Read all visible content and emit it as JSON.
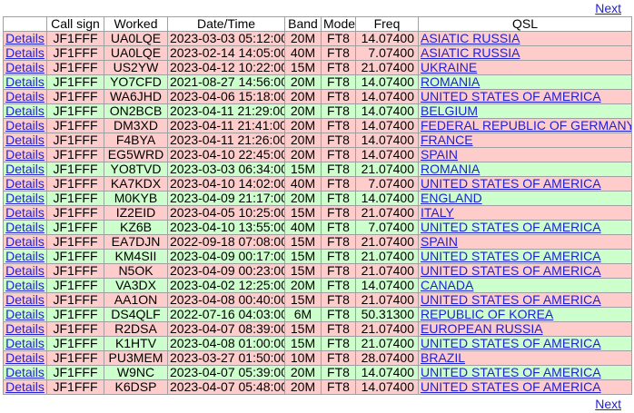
{
  "nav": {
    "next_label": "Next"
  },
  "table": {
    "headers": [
      "",
      "Call sign",
      "Worked",
      "Date/Time",
      "Band",
      "Mode",
      "Freq",
      "QSL"
    ],
    "details_label": "Details",
    "rows": [
      {
        "call": "JF1FFF",
        "worked": "UA0LQE",
        "datetime": "2023-03-03 05:12:00",
        "band": "20M",
        "mode": "FT8",
        "freq": "14.07400",
        "qsl": "ASIATIC RUSSIA",
        "color": "pink"
      },
      {
        "call": "JF1FFF",
        "worked": "UA0LQE",
        "datetime": "2023-02-14 14:05:00",
        "band": "40M",
        "mode": "FT8",
        "freq": "7.07400",
        "qsl": "ASIATIC RUSSIA",
        "color": "pink"
      },
      {
        "call": "JF1FFF",
        "worked": "US2YW",
        "datetime": "2023-04-12 10:22:00",
        "band": "15M",
        "mode": "FT8",
        "freq": "21.07400",
        "qsl": "UKRAINE",
        "color": "pink"
      },
      {
        "call": "JF1FFF",
        "worked": "YO7CFD",
        "datetime": "2021-08-27 14:56:00",
        "band": "20M",
        "mode": "FT8",
        "freq": "14.07400",
        "qsl": "ROMANIA",
        "color": "green"
      },
      {
        "call": "JF1FFF",
        "worked": "WA6JHD",
        "datetime": "2023-04-06 15:18:00",
        "band": "20M",
        "mode": "FT8",
        "freq": "14.07400",
        "qsl": "UNITED STATES OF AMERICA",
        "color": "pink"
      },
      {
        "call": "JF1FFF",
        "worked": "ON2BCB",
        "datetime": "2023-04-11 21:29:00",
        "band": "20M",
        "mode": "FT8",
        "freq": "14.07400",
        "qsl": "BELGIUM",
        "color": "green"
      },
      {
        "call": "JF1FFF",
        "worked": "DM3XD",
        "datetime": "2023-04-11 21:41:00",
        "band": "20M",
        "mode": "FT8",
        "freq": "14.07400",
        "qsl": "FEDERAL REPUBLIC OF GERMANY",
        "color": "pink"
      },
      {
        "call": "JF1FFF",
        "worked": "F4BYA",
        "datetime": "2023-04-11 21:26:00",
        "band": "20M",
        "mode": "FT8",
        "freq": "14.07400",
        "qsl": "FRANCE",
        "color": "pink"
      },
      {
        "call": "JF1FFF",
        "worked": "EG5WRD",
        "datetime": "2023-04-10 22:45:00",
        "band": "20M",
        "mode": "FT8",
        "freq": "14.07400",
        "qsl": "SPAIN",
        "color": "pink"
      },
      {
        "call": "JF1FFF",
        "worked": "YO8TVD",
        "datetime": "2023-03-03 06:34:00",
        "band": "15M",
        "mode": "FT8",
        "freq": "21.07400",
        "qsl": "ROMANIA",
        "color": "green"
      },
      {
        "call": "JF1FFF",
        "worked": "KA7KDX",
        "datetime": "2023-04-10 14:02:00",
        "band": "40M",
        "mode": "FT8",
        "freq": "7.07400",
        "qsl": "UNITED STATES OF AMERICA",
        "color": "pink"
      },
      {
        "call": "JF1FFF",
        "worked": "M0KYB",
        "datetime": "2023-04-09 21:17:00",
        "band": "20M",
        "mode": "FT8",
        "freq": "14.07400",
        "qsl": "ENGLAND",
        "color": "green"
      },
      {
        "call": "JF1FFF",
        "worked": "IZ2EID",
        "datetime": "2023-04-05 10:25:00",
        "band": "15M",
        "mode": "FT8",
        "freq": "21.07400",
        "qsl": "ITALY",
        "color": "pink"
      },
      {
        "call": "JF1FFF",
        "worked": "KZ6B",
        "datetime": "2023-04-10 13:55:00",
        "band": "40M",
        "mode": "FT8",
        "freq": "7.07400",
        "qsl": "UNITED STATES OF AMERICA",
        "color": "green"
      },
      {
        "call": "JF1FFF",
        "worked": "EA7DJN",
        "datetime": "2022-09-18 07:08:00",
        "band": "15M",
        "mode": "FT8",
        "freq": "21.07400",
        "qsl": "SPAIN",
        "color": "pink"
      },
      {
        "call": "JF1FFF",
        "worked": "KM4SII",
        "datetime": "2023-04-09 00:17:00",
        "band": "15M",
        "mode": "FT8",
        "freq": "21.07400",
        "qsl": "UNITED STATES OF AMERICA",
        "color": "green"
      },
      {
        "call": "JF1FFF",
        "worked": "N5OK",
        "datetime": "2023-04-09 00:23:00",
        "band": "15M",
        "mode": "FT8",
        "freq": "21.07400",
        "qsl": "UNITED STATES OF AMERICA",
        "color": "pink"
      },
      {
        "call": "JF1FFF",
        "worked": "VA3DX",
        "datetime": "2023-04-02 12:25:00",
        "band": "20M",
        "mode": "FT8",
        "freq": "14.07400",
        "qsl": "CANADA",
        "color": "green"
      },
      {
        "call": "JF1FFF",
        "worked": "AA1ON",
        "datetime": "2023-04-08 00:40:00",
        "band": "15M",
        "mode": "FT8",
        "freq": "21.07400",
        "qsl": "UNITED STATES OF AMERICA",
        "color": "pink"
      },
      {
        "call": "JF1FFF",
        "worked": "DS4QLF",
        "datetime": "2022-07-16 04:03:00",
        "band": "6M",
        "mode": "FT8",
        "freq": "50.31300",
        "qsl": "REPUBLIC OF KOREA",
        "color": "green"
      },
      {
        "call": "JF1FFF",
        "worked": "R2DSA",
        "datetime": "2023-04-07 08:39:00",
        "band": "15M",
        "mode": "FT8",
        "freq": "21.07400",
        "qsl": "EUROPEAN RUSSIA",
        "color": "pink"
      },
      {
        "call": "JF1FFF",
        "worked": "K1HTV",
        "datetime": "2023-04-08 01:00:00",
        "band": "15M",
        "mode": "FT8",
        "freq": "21.07400",
        "qsl": "UNITED STATES OF AMERICA",
        "color": "green"
      },
      {
        "call": "JF1FFF",
        "worked": "PU3MEM",
        "datetime": "2023-03-27 01:50:00",
        "band": "10M",
        "mode": "FT8",
        "freq": "28.07400",
        "qsl": "BRAZIL",
        "color": "pink"
      },
      {
        "call": "JF1FFF",
        "worked": "W9NC",
        "datetime": "2023-04-07 05:39:00",
        "band": "20M",
        "mode": "FT8",
        "freq": "14.07400",
        "qsl": "UNITED STATES OF AMERICA",
        "color": "green"
      },
      {
        "call": "JF1FFF",
        "worked": "K6DSP",
        "datetime": "2023-04-07 05:48:00",
        "band": "20M",
        "mode": "FT8",
        "freq": "14.07400",
        "qsl": "UNITED STATES OF AMERICA",
        "color": "pink"
      }
    ]
  },
  "colors": {
    "pink_row": "#ffcccc",
    "green_row": "#ccffcc",
    "link": "#1f1fd6"
  }
}
